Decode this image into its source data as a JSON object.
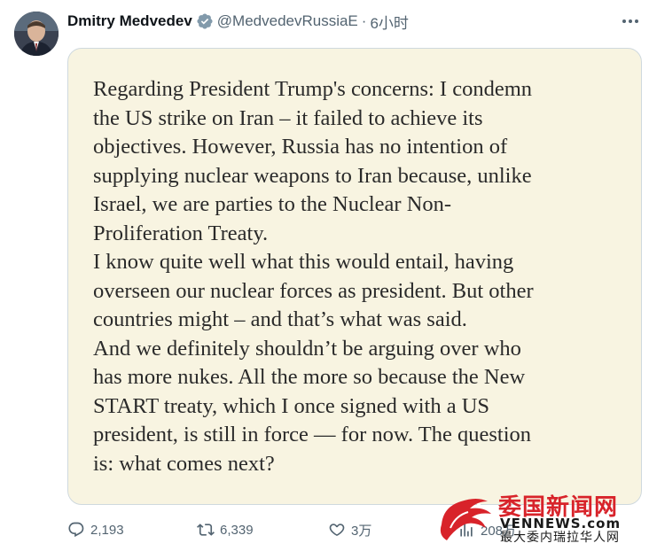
{
  "author": {
    "display_name": "Dmitry Medvedev",
    "handle": "@MedvedevRussiaE",
    "separator": "·",
    "time": "6小时",
    "verified_color": "#829aab",
    "avatar": "avatar-portrait"
  },
  "post": {
    "statement": "Regarding President Trump's concerns: I condemn\nthe US strike on Iran – it failed to achieve its\nobjectives. However, Russia has no intention of\nsupplying nuclear weapons to Iran because, unlike\nIsrael, we are parties to the Nuclear Non-\nProliferation Treaty.\nI know quite well what this would entail, having\noverseen our nuclear forces as president. But other\ncountries might – and that’s what was said.\nAnd we definitely shouldn’t be arguing over who\nhas more nukes. All the more so because the New\nSTART treaty, which I once signed with a US\npresident, is still in force — for now. The question\nis: what comes next?",
    "card_background": "#f8f4e1"
  },
  "actions": {
    "replies": "2,193",
    "reposts": "6,339",
    "likes": "3万",
    "views": "208万"
  },
  "watermark": {
    "title": "委国新闻网",
    "site": "VENNEWS.com",
    "subtitle": "最大委内瑞拉华人网",
    "color": "#d8232a"
  },
  "icons": {
    "reply": "reply-icon",
    "repost": "repost-icon",
    "like": "heart-icon",
    "views": "views-icon",
    "more": "more-dots-icon",
    "verified": "verified-badge-icon"
  }
}
